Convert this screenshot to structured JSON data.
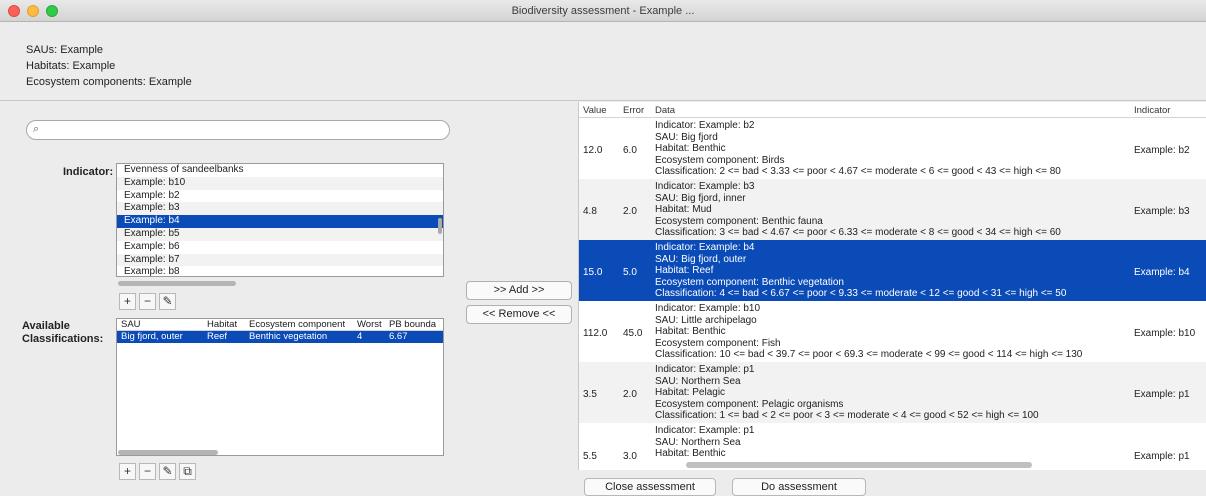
{
  "window": {
    "title": "Biodiversity assessment - Example ..."
  },
  "info": {
    "saus": "SAUs: Example",
    "habitats": "Habitats: Example",
    "components": "Ecosystem components: Example"
  },
  "left": {
    "search_icon": "⌕",
    "indicator_label": "Indicator:",
    "indicators": [
      "Evenness of sandeelbanks",
      "Example: b10",
      "Example: b2",
      "Example: b3",
      "Example: b4",
      "Example: b5",
      "Example: b6",
      "Example: b7",
      "Example: b8"
    ],
    "selected_indicator": "Example: b4",
    "toolbar1": [
      "+",
      "−",
      "✎"
    ],
    "classifications_label1": "Available",
    "classifications_label2": "Classifications:",
    "class_headers": [
      "SAU",
      "Habitat",
      "Ecosystem component",
      "Worst",
      "PB bounda"
    ],
    "class_rows": [
      [
        "Big fjord, outer",
        "Reef",
        "Benthic vegetation",
        "4",
        "6.67"
      ]
    ],
    "toolbar2": [
      "+",
      "−",
      "✎",
      "⧉"
    ]
  },
  "mid": {
    "add": ">> Add >>",
    "remove": "<< Remove <<"
  },
  "table": {
    "headers": [
      "Value",
      "Error",
      "Data",
      "Indicator"
    ],
    "rows": [
      {
        "value": "12.0",
        "error": "6.0",
        "data": [
          "Indicator: Example: b2",
          "SAU: Big fjord",
          "Habitat: Benthic",
          "Ecosystem component: Birds",
          "Classification: 2 <= bad < 3.33 <= poor < 4.67 <= moderate < 6 <= good < 43 <= high <= 80"
        ],
        "indicator": "Example: b2"
      },
      {
        "value": "4.8",
        "error": "2.0",
        "data": [
          "Indicator: Example: b3",
          "SAU: Big fjord, inner",
          "Habitat: Mud",
          "Ecosystem component: Benthic fauna",
          "Classification: 3 <= bad < 4.67 <= poor < 6.33 <= moderate < 8 <= good < 34 <= high <= 60"
        ],
        "indicator": "Example: b3"
      },
      {
        "value": "15.0",
        "error": "5.0",
        "data": [
          "Indicator: Example: b4",
          "SAU: Big fjord, outer",
          "Habitat: Reef",
          "Ecosystem component: Benthic vegetation",
          "Classification: 4 <= bad < 6.67 <= poor < 9.33 <= moderate < 12 <= good < 31 <= high <= 50"
        ],
        "indicator": "Example: b4"
      },
      {
        "value": "112.0",
        "error": "45.0",
        "data": [
          "Indicator: Example: b10",
          "SAU: Little archipelago",
          "Habitat: Benthic",
          "Ecosystem component: Fish",
          "Classification: 10 <= bad < 39.7 <= poor < 69.3 <= moderate < 99 <= good < 114 <= high <= 130"
        ],
        "indicator": "Example: b10"
      },
      {
        "value": "3.5",
        "error": "2.0",
        "data": [
          "Indicator: Example: p1",
          "SAU: Northern Sea",
          "Habitat: Pelagic",
          "Ecosystem component: Pelagic organisms",
          "Classification: 1 <= bad < 2 <= poor < 3 <= moderate < 4 <= good < 52 <= high <= 100"
        ],
        "indicator": "Example: p1"
      },
      {
        "value": "5.5",
        "error": "3.0",
        "data": [
          "Indicator: Example: p1",
          "SAU: Northern Sea",
          "Habitat: Benthic"
        ],
        "indicator": "Example: p1"
      }
    ]
  },
  "bottom": {
    "close": "Close assessment",
    "do": "Do assessment"
  },
  "colors": {
    "selection": "#0a4bb8",
    "alt_row": "#f2f2f2",
    "close_light": "#fc605b",
    "min_light": "#fdbc40",
    "max_light": "#34c84a"
  }
}
